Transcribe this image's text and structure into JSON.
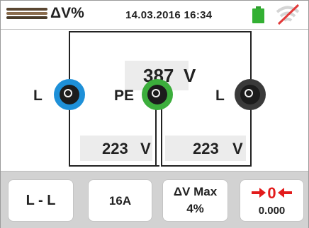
{
  "header": {
    "title": "ΔV%",
    "datetime": "14.03.2016 16:34",
    "icons": [
      "cable-icon",
      "battery-icon",
      "no-wifi-icon"
    ],
    "battery_color": "#33b033",
    "nowifi_slash_color": "#e23a3a"
  },
  "measurement": {
    "main_value": "387",
    "main_unit": "V",
    "left_value": "223",
    "left_unit": "V",
    "right_value": "223",
    "right_unit": "V"
  },
  "terminals": [
    {
      "label": "L",
      "color": "#1e90d8"
    },
    {
      "label": "PE",
      "color": "#3cae3c"
    },
    {
      "label": "L",
      "color": "#3a3a3a"
    }
  ],
  "buttons": {
    "mode": "L - L",
    "current": "16A",
    "dv_max_title": "ΔV Max",
    "dv_max_value": "4%",
    "zero_value": "0.000",
    "zero_icon": "zero-offset-icon",
    "zero_icon_color": "#e21b1b"
  }
}
